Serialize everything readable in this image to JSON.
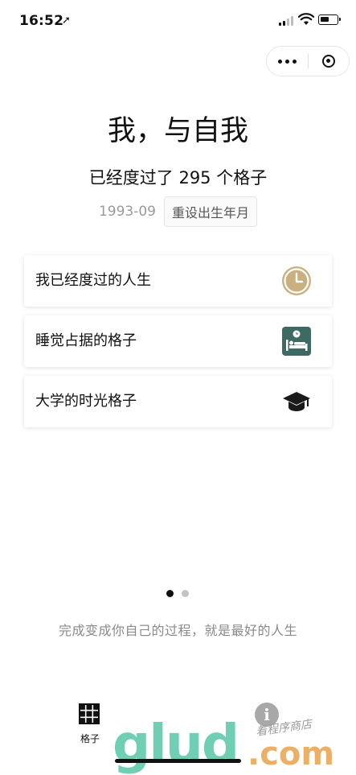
{
  "status_bar": {
    "time": "16:52",
    "location_glyph": "➚"
  },
  "capsule": {
    "more_icon": "more-dots-icon",
    "close_icon": "target-circle-icon"
  },
  "header": {
    "title": "我，与自我",
    "subtitle": "已经度过了 295 个格子",
    "birth_date": "1993-09",
    "reset_label": "重设出生年月"
  },
  "cards": [
    {
      "label": "我已经度过的人生",
      "icon": "clock-icon",
      "color": "#c9b080"
    },
    {
      "label": "睡觉占据的格子",
      "icon": "bed-icon",
      "color": "#3f6a63"
    },
    {
      "label": "大学的时光格子",
      "icon": "graduation-cap-icon",
      "color": "#1a1a1a"
    }
  ],
  "pager": {
    "total": 2,
    "active": 1,
    "active_color": "#111111",
    "inactive_color": "#c4c4c4"
  },
  "motto": "完成变成你自己的过程，就是最好的人生",
  "tabbar": {
    "tabs": [
      {
        "label": "格子",
        "icon": "grid-icon",
        "active": true
      },
      {
        "label": "",
        "icon": "info-icon",
        "active": false
      }
    ]
  },
  "watermark": {
    "brand": "glud",
    "suffix": ".com",
    "handwriting": "着程序商店"
  }
}
